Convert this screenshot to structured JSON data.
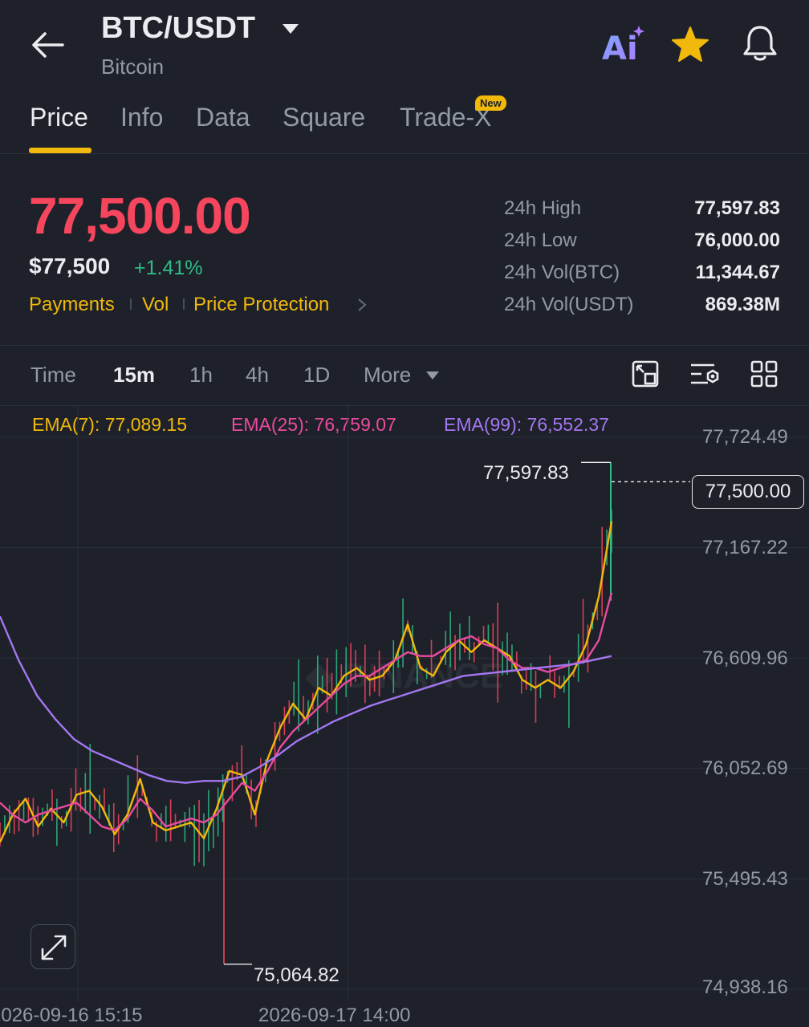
{
  "header": {
    "pair": "BTC/USDT",
    "subtitle": "Bitcoin",
    "ai_label": "Ai"
  },
  "tabs": [
    {
      "label": "Price"
    },
    {
      "label": "Info"
    },
    {
      "label": "Data"
    },
    {
      "label": "Square"
    },
    {
      "label": "Trade-X"
    }
  ],
  "new_badge": "New",
  "price": {
    "last": "77,500.00",
    "usd": "$77,500",
    "change": "+1.41%",
    "links": [
      "Payments",
      "Vol",
      "Price Protection"
    ]
  },
  "stats": [
    {
      "label": "24h High",
      "value": "77,597.83"
    },
    {
      "label": "24h Low",
      "value": "76,000.00"
    },
    {
      "label": "24h Vol(BTC)",
      "value": "11,344.67"
    },
    {
      "label": "24h Vol(USDT)",
      "value": "869.38M"
    }
  ],
  "intervals": [
    "Time",
    "15m",
    "1h",
    "4h",
    "1D",
    "More"
  ],
  "ema": {
    "ema7": "EMA(7): 77,089.15",
    "ema25": "EMA(25): 76,759.07",
    "ema99": "EMA(99): 76,552.37"
  },
  "chart_data": {
    "type": "line",
    "y_ticks": [
      "77,724.49",
      "77,167.22",
      "76,609.96",
      "76,052.69",
      "75,495.43",
      "74,938.16"
    ],
    "x_ticks": [
      "2026-09-16 15:15",
      "2026-09-17 14:00"
    ],
    "high_label": "77,597.83",
    "low_label": "75,064.82",
    "current_label": "77,500.00",
    "ylim": [
      74938.16,
      77724.49
    ],
    "series": [
      {
        "name": "EMA(7)",
        "color": "#f0b90b",
        "values": [
          75680,
          75820,
          75900,
          75760,
          75850,
          75780,
          75920,
          75940,
          75860,
          75720,
          75820,
          76000,
          75780,
          75740,
          75760,
          75780,
          75700,
          75850,
          76040,
          76020,
          75820,
          76100,
          76260,
          76380,
          76300,
          76460,
          76420,
          76520,
          76560,
          76500,
          76520,
          76600,
          76780,
          76560,
          76520,
          76640,
          76700,
          76640,
          76700,
          76660,
          76620,
          76500,
          76460,
          76500,
          76460,
          76540,
          76680,
          76920,
          77300
        ]
      },
      {
        "name": "EMA(25)",
        "color": "#e94ba1",
        "values": [
          75880,
          75820,
          75780,
          75820,
          75840,
          75860,
          75880,
          75820,
          75760,
          75740,
          75800,
          75900,
          75840,
          75760,
          75780,
          75800,
          75780,
          75820,
          75900,
          75980,
          75940,
          76040,
          76160,
          76240,
          76300,
          76360,
          76420,
          76480,
          76520,
          76520,
          76560,
          76600,
          76640,
          76620,
          76620,
          76660,
          76700,
          76720,
          76680,
          76660,
          76600,
          76560,
          76560,
          76540,
          76560,
          76580,
          76600,
          76700,
          76940
        ]
      },
      {
        "name": "EMA(99)",
        "color": "#a477f2",
        "values": [
          76820,
          76600,
          76420,
          76300,
          76200,
          76140,
          76100,
          76060,
          76020,
          75990,
          75980,
          75990,
          75990,
          76010,
          76060,
          76120,
          76190,
          76240,
          76290,
          76330,
          76370,
          76400,
          76430,
          76460,
          76490,
          76520,
          76530,
          76540,
          76550,
          76560,
          76570,
          76580,
          76600,
          76620
        ]
      }
    ]
  }
}
